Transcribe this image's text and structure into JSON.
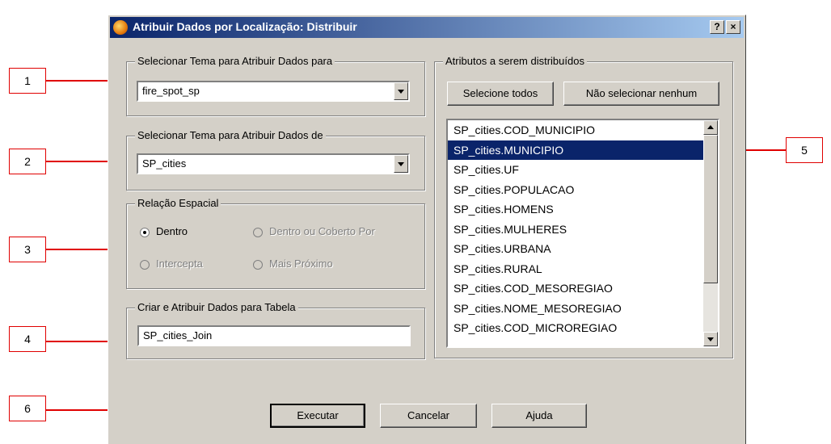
{
  "dialog": {
    "title": "Atribuir Dados por Localização: Distribuir",
    "help_button": "?",
    "close_button": "×"
  },
  "group_target": {
    "legend": "Selecionar Tema para Atribuir Dados para",
    "value": "fire_spot_sp"
  },
  "group_source": {
    "legend": "Selecionar Tema para Atribuir Dados de",
    "value": "SP_cities"
  },
  "spatial": {
    "legend": "Relação Espacial",
    "options": [
      "Dentro",
      "Dentro ou Coberto Por",
      "Intercepta",
      "Mais Próximo"
    ],
    "selected": "Dentro"
  },
  "table": {
    "legend": "Criar e Atribuir Dados para Tabela",
    "value": "SP_cities_Join"
  },
  "attributes": {
    "legend": "Atributos a serem distribuídos",
    "select_all": "Selecione todos",
    "select_none": "Não selecionar nenhum",
    "items": [
      "SP_cities.COD_MUNICIPIO",
      "SP_cities.MUNICIPIO",
      "SP_cities.UF",
      "SP_cities.POPULACAO",
      "SP_cities.HOMENS",
      "SP_cities.MULHERES",
      "SP_cities.URBANA",
      "SP_cities.RURAL",
      "SP_cities.COD_MESOREGIAO",
      "SP_cities.NOME_MESOREGIAO",
      "SP_cities.COD_MICROREGIAO"
    ],
    "selected_item": "SP_cities.MUNICIPIO"
  },
  "buttons": {
    "execute": "Executar",
    "cancel": "Cancelar",
    "help": "Ajuda"
  },
  "callouts": [
    "1",
    "2",
    "3",
    "4",
    "5",
    "6"
  ],
  "colors": {
    "title_start": "#0a246a",
    "title_end": "#a6caf0",
    "dialog_bg": "#d4d0c8",
    "selection": "#0a246a",
    "callout_red": "#e00000"
  }
}
